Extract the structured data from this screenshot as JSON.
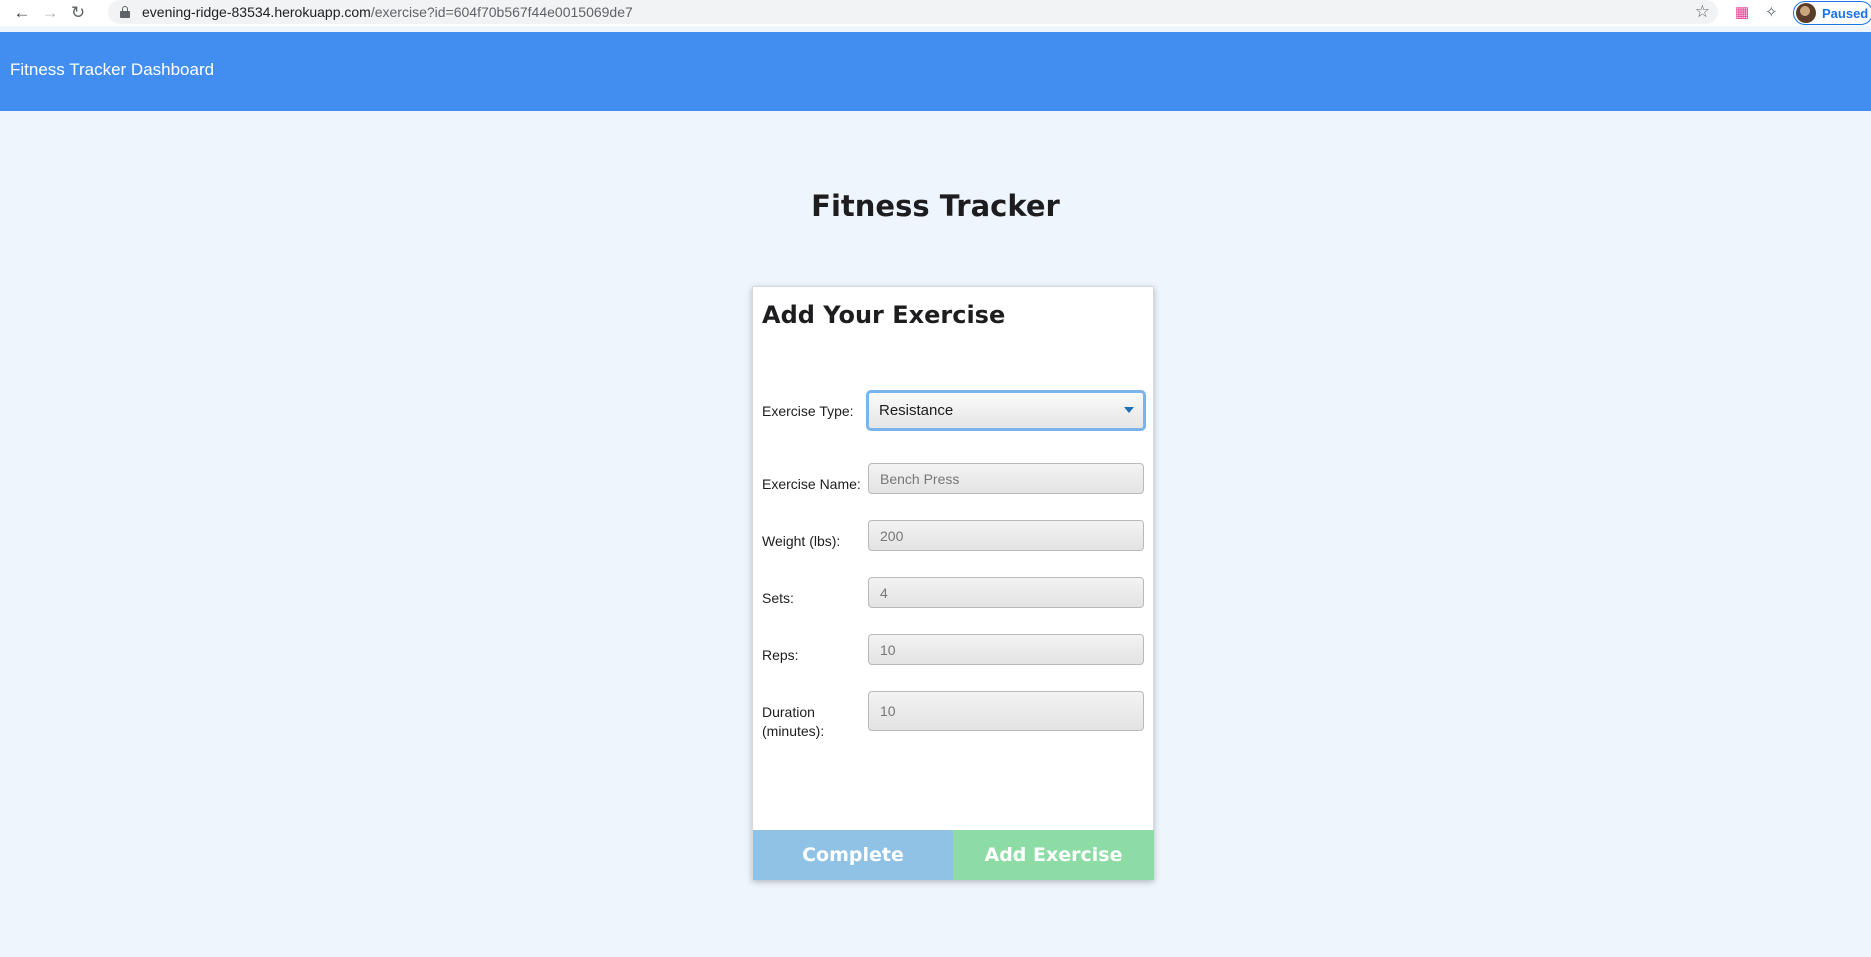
{
  "browser": {
    "url_host": "evening-ridge-83534.herokuapp.com",
    "url_path": "/exercise?id=604f70b567f44e0015069de7",
    "profile_status": "Paused"
  },
  "header": {
    "brand": "Fitness Tracker Dashboard"
  },
  "page": {
    "title": "Fitness Tracker"
  },
  "form": {
    "heading": "Add Your Exercise",
    "exercise_type": {
      "label": "Exercise Type:",
      "value": "Resistance"
    },
    "exercise_name": {
      "label": "Exercise Name:",
      "value": "Bench Press"
    },
    "weight": {
      "label": "Weight (lbs):",
      "value": "200"
    },
    "sets": {
      "label": "Sets:",
      "value": "4"
    },
    "reps": {
      "label": "Reps:",
      "value": "10"
    },
    "duration": {
      "label_line1": "Duration",
      "label_line2": "(minutes):",
      "value": "10"
    },
    "complete_label": "Complete",
    "add_label": "Add Exercise"
  },
  "colors": {
    "header": "#428df0",
    "background": "#eef5fd",
    "complete_button": "#8fc2e5",
    "add_button": "#8ddca6"
  }
}
